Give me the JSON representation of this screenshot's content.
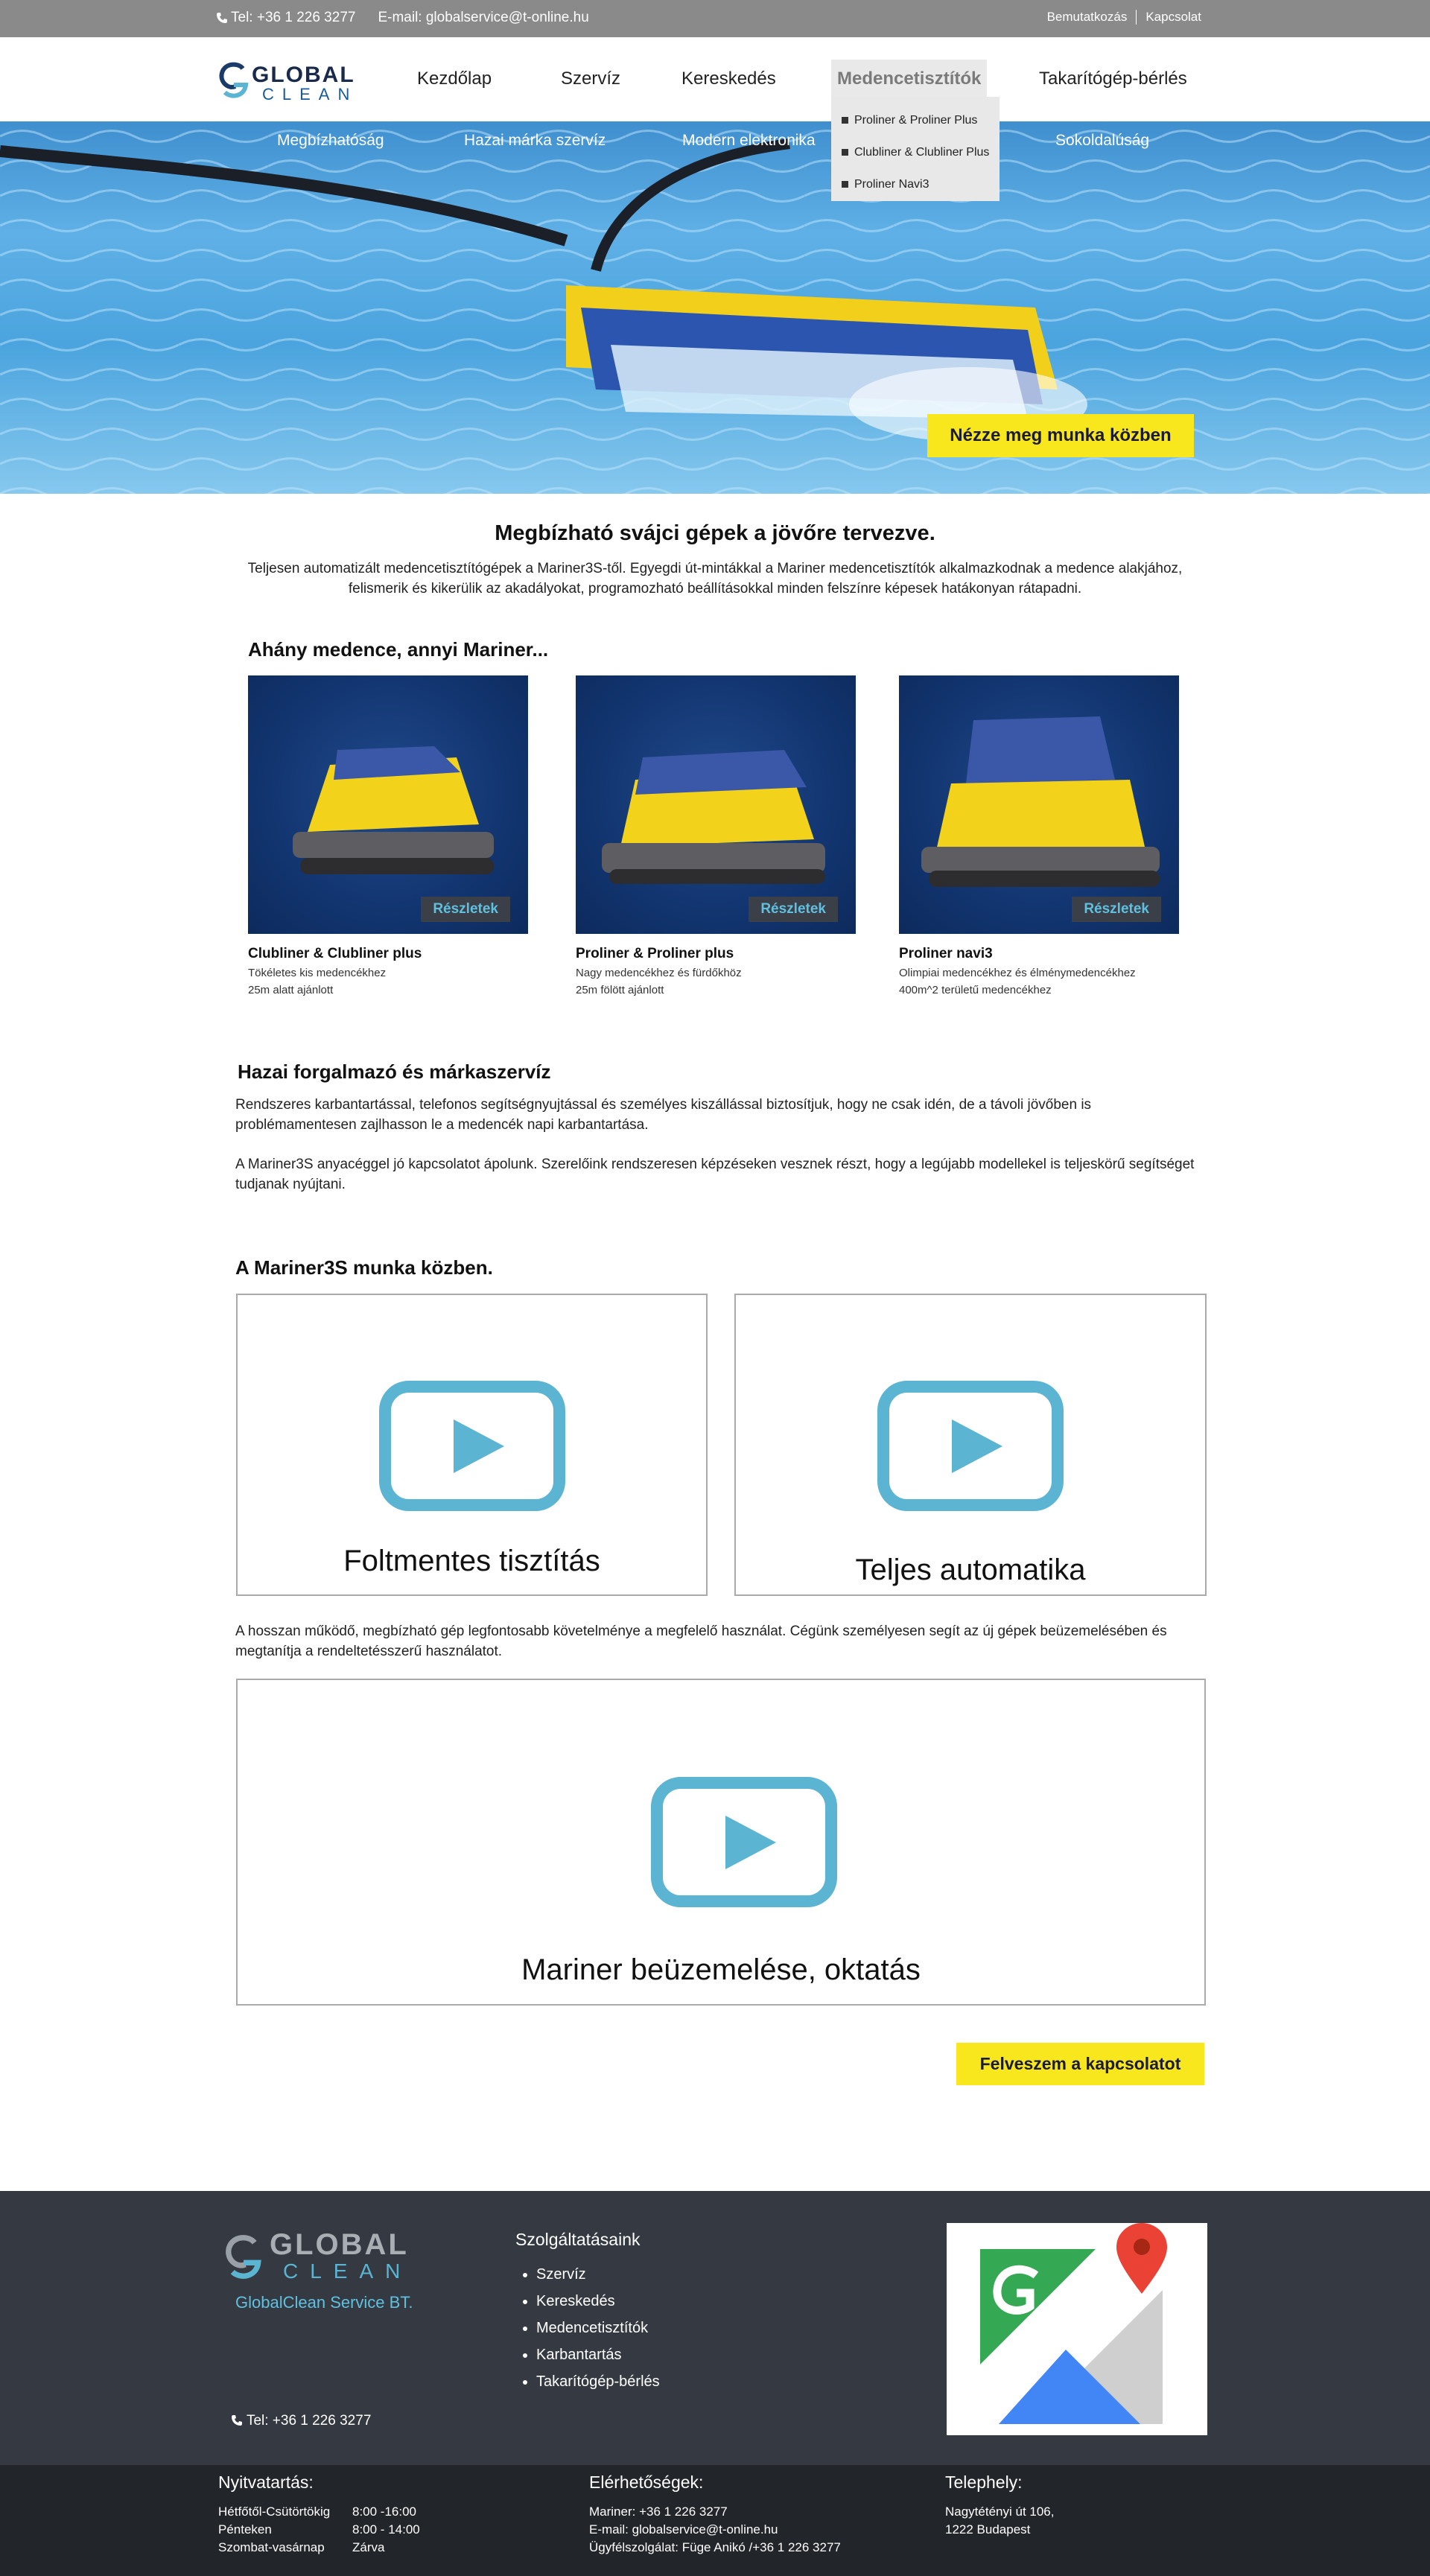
{
  "topbar": {
    "tel": "Tel: +36 1 226 3277",
    "email": "E-mail: globalservice@t-online.hu",
    "links": [
      "Bemutatkozás",
      "Kapcsolat"
    ]
  },
  "logo": {
    "line1": "GLOBAL",
    "line2": "CLEAN"
  },
  "nav": {
    "items": [
      "Kezdőlap",
      "Szervíz",
      "Kereskedés",
      "Medencetisztítók",
      "Takarítógép-bérlés"
    ],
    "active_index": 3,
    "dropdown": [
      "Proliner & Proliner Plus",
      "Clubliner & Clubliner Plus",
      "Proliner Navi3"
    ]
  },
  "hero": {
    "subnav": [
      "Megbízhatóság",
      "Hazai márka szervíz",
      "Modern elektronika",
      "Sokoldalúság"
    ],
    "button": "Nézze meg munka közben"
  },
  "intro": {
    "title": "Megbízható svájci gépek a jövőre tervezve.",
    "text": "Teljesen automatizált medencetisztítógépek a Mariner3S-től. Egyegdi út-mintákkal a Mariner medencetisztítók alkalmazkodnak a medence alakjához, felismerik és kikerülik az akadályokat, programozható beállításokkal minden felszínre képesek hatákonyan rátapadni."
  },
  "products": {
    "title": "Ahány medence, annyi Mariner...",
    "badge": "Részletek",
    "items": [
      {
        "name": "Clubliner & Clubliner plus",
        "d1": "Tökéletes kis medencékhez",
        "d2": "25m alatt ajánlott"
      },
      {
        "name": "Proliner & Proliner plus",
        "d1": "Nagy medencékhez és fürdőkhöz",
        "d2": "25m fölött ajánlott"
      },
      {
        "name": "Proliner navi3",
        "d1": "Olimpiai medencékhez és élménymedencékhez",
        "d2": "400m^2 területű medencékhez"
      }
    ]
  },
  "service": {
    "title": "Hazai forgalmazó és márkaszervíz",
    "p1": "Rendszeres karbantartással, telefonos segítségnyujtással és személyes kiszállással biztosítjuk, hogy ne csak idén, de a távoli jövőben is problémamentesen zajlhasson le a medencék napi karbantartása.",
    "p2": "A Mariner3S anyacéggel jó kapcsolatot ápolunk. Szerelőink rendszeresen képzéseken vesznek részt, hogy a legújabb modellekel is teljeskörű segítséget tudjanak nyújtani."
  },
  "videos": {
    "title": "A Mariner3S munka közben.",
    "v1": "Foltmentes tisztítás",
    "v2": "Teljes automatika",
    "para": "A hosszan működő, megbízható gép legfontosabb követelménye a megfelelő használat. Cégünk személyesen segít az új gépek beüzemelésében és megtanítja a rendeltetésszerű használatot.",
    "v3": "Mariner beüzemelése, oktatás"
  },
  "cta": "Felveszem a kapcsolatot",
  "footer": {
    "company": "GlobalClean Service BT.",
    "tel": "Tel: +36 1 226 3277",
    "services_title": "Szolgáltatásaink",
    "services": [
      "Szervíz",
      "Kereskedés",
      "Medencetisztítók",
      "Karbantartás",
      "Takarítógép-bérlés"
    ]
  },
  "bottom": {
    "hours_title": "Nyitvatartás:",
    "hours": [
      [
        "Hétfőtől-Csütörtökig",
        "8:00 -16:00"
      ],
      [
        "Pénteken",
        "8:00 - 14:00"
      ],
      [
        "Szombat-vasárnap",
        "Zárva"
      ]
    ],
    "contact_title": "Elérhetőségek:",
    "contact": [
      "Mariner: +36 1 226 3277",
      "E-mail: globalservice@t-online.hu",
      "Ügyfélszolgálat: Füge Anikó /+36 1 226 3277"
    ],
    "site_title": "Telephely:",
    "site": [
      "Nagytétényi út 106,",
      "1222 Budapest"
    ]
  },
  "colors": {
    "accent_yellow": "#f8e71c",
    "play_blue": "#5ab4d2",
    "footer_bg": "#353a42",
    "bottom_bg": "#22252a",
    "topbar_bg": "#8a8a8a"
  }
}
